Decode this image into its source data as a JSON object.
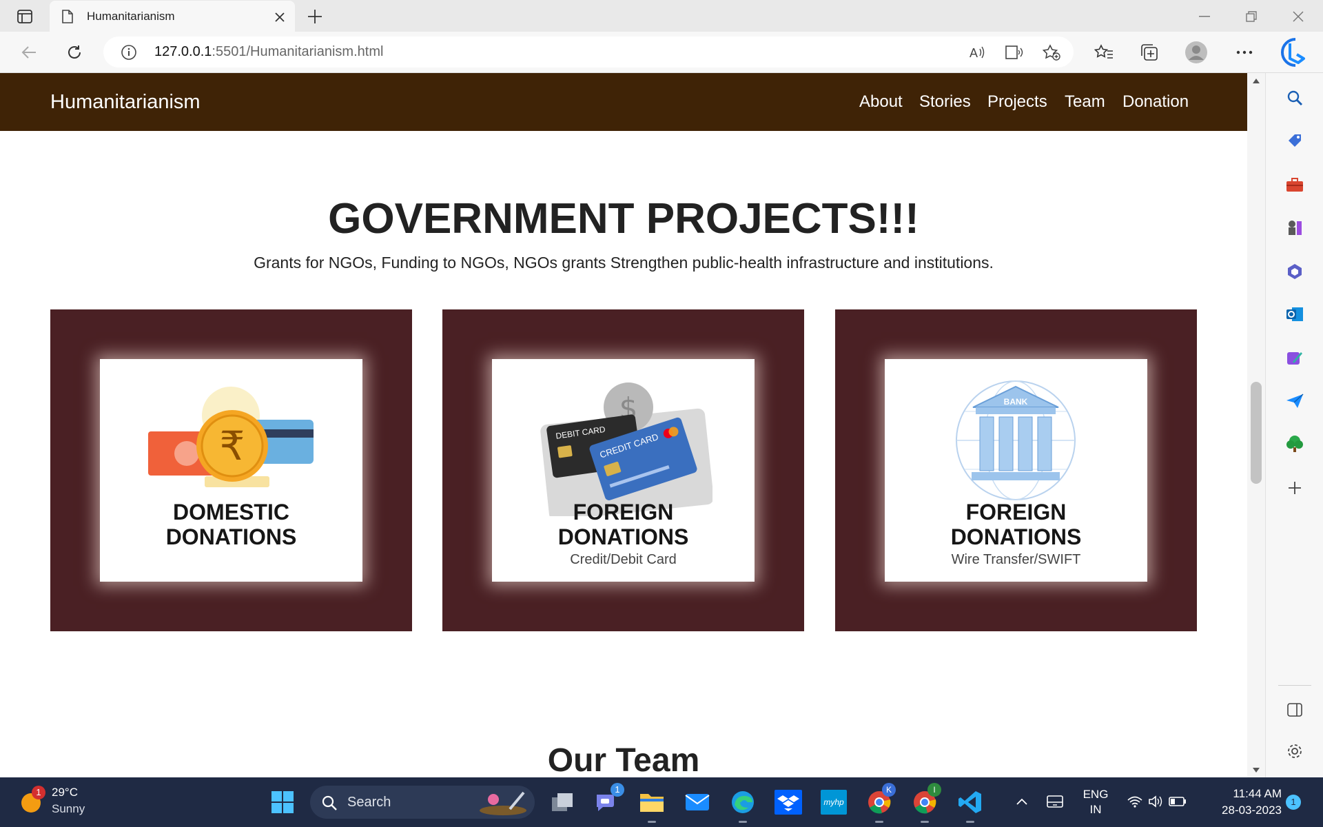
{
  "browser": {
    "tab_title": "Humanitarianism",
    "url_host": "127.0.0.1",
    "url_rest": ":5501/Humanitarianism.html"
  },
  "site": {
    "brand": "Humanitarianism",
    "nav": [
      "About",
      "Stories",
      "Projects",
      "Team",
      "Donation"
    ]
  },
  "projects": {
    "heading": "GOVERNMENT PROJECTS!!!",
    "subheading": "Grants for NGOs, Funding to NGOs, NGOs grants Strengthen public-health infrastructure and institutions.",
    "cards": [
      {
        "line1": "DOMESTIC",
        "line2": "DONATIONS",
        "sub": "",
        "icon": "rupee-coin-icon"
      },
      {
        "line1": "FOREIGN",
        "line2": "DONATIONS",
        "sub": "Credit/Debit Card",
        "icon": "credit-card-icon",
        "card_label_debit": "DEBIT CARD",
        "card_label_credit": "CREDIT CARD"
      },
      {
        "line1": "FOREIGN",
        "line2": "DONATIONS",
        "sub": "Wire Transfer/SWIFT",
        "icon": "bank-globe-icon",
        "bank_label": "BANK"
      }
    ]
  },
  "team": {
    "heading": "Our Team"
  },
  "taskbar": {
    "weather_temp": "29°C",
    "weather_desc": "Sunny",
    "weather_badge": "1",
    "search": "Search",
    "teams_badge": "1",
    "chrome1_badge": "K",
    "chrome2_badge": "I",
    "lang1": "ENG",
    "lang2": "IN",
    "time": "11:44 AM",
    "date": "28-03-2023",
    "notif": "1",
    "hp_label": "myhp"
  },
  "colors": {
    "navbar": "#3f2306",
    "card": "#4a2024",
    "taskbar": "#1f2a44"
  }
}
